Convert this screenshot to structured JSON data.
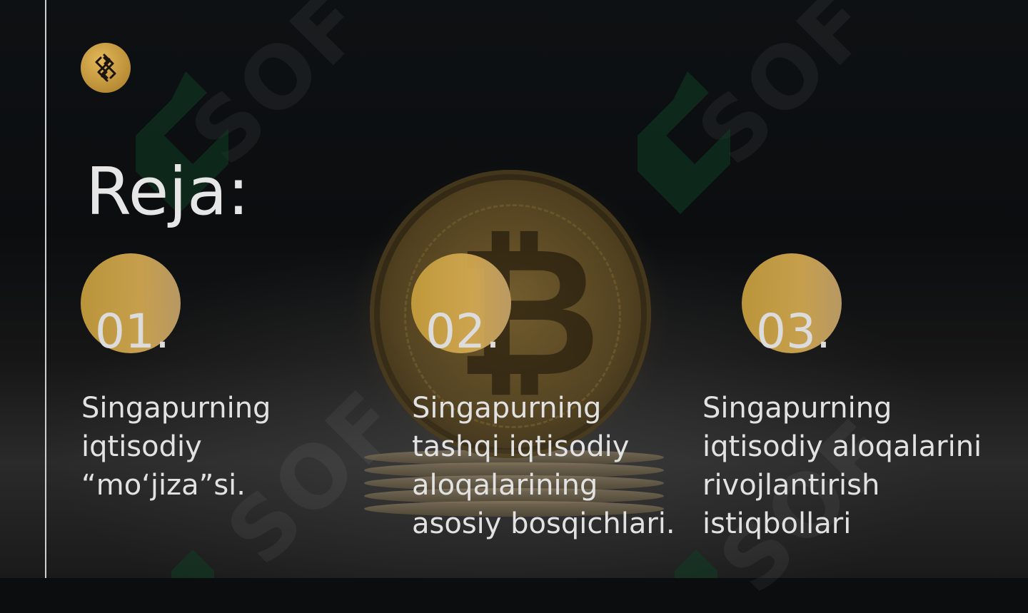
{
  "slide": {
    "title": "Reja:",
    "items": [
      {
        "number": "01.",
        "text": "Singapurning\niqtisodiy\n“mo‘jiza”si."
      },
      {
        "number": "02.",
        "text": "Singapurning\ntashqi iqtisodiy\naloqalarining\nasosiy bosqichlari."
      },
      {
        "number": "03.",
        "text": " Singapurning\niqtisodiy aloqalarini\nrivojlantirish\nistiqbollari"
      }
    ]
  },
  "colors": {
    "background": "#0b0d0e",
    "accent_gold": "#d6ab52",
    "text": "#e2e2e2",
    "watermark_green": "#0f3d24"
  },
  "icons": {
    "logo": "brand-logo-icon",
    "coin": "bitcoin-coin-image"
  }
}
